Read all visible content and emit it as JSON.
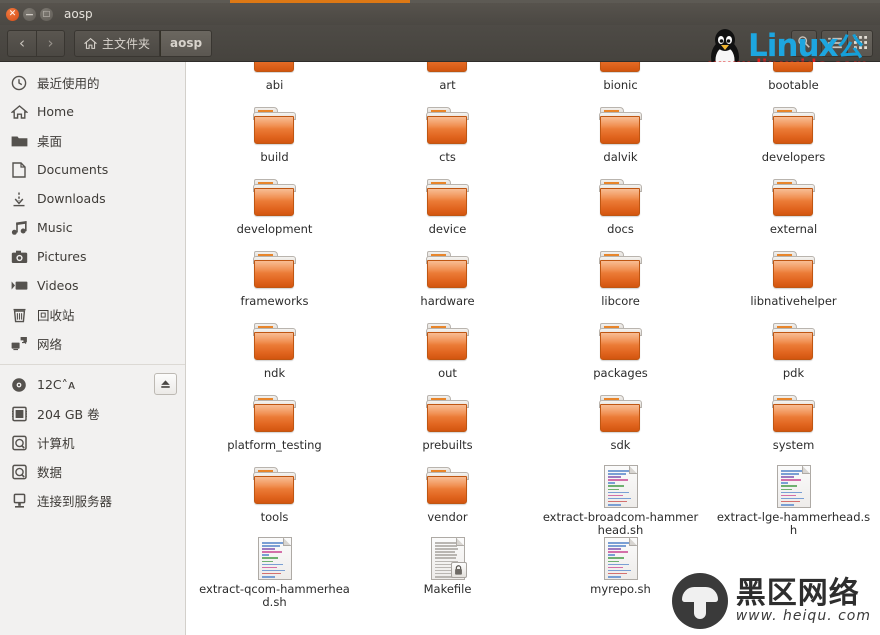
{
  "window": {
    "title": "aosp",
    "controls": [
      {
        "name": "close",
        "glyph": "✕"
      },
      {
        "name": "minimize",
        "glyph": "−"
      },
      {
        "name": "maximize",
        "glyph": "□"
      }
    ]
  },
  "toolbar": {
    "back_label": "‹",
    "forward_label": "›",
    "breadcrumbs": [
      {
        "label": "主文件夹",
        "icon": "home-icon",
        "current": false
      },
      {
        "label": "aosp",
        "icon": "",
        "current": true
      }
    ],
    "search_icon": "search-icon",
    "list_view_icon": "list-view-icon",
    "grid_view_icon": "grid-view-icon"
  },
  "sidebar": {
    "groups": [
      {
        "items": [
          {
            "label": "最近使用的",
            "icon": "clock-icon"
          },
          {
            "label": "Home",
            "icon": "home-icon"
          },
          {
            "label": "桌面",
            "icon": "folder-icon"
          },
          {
            "label": "Documents",
            "icon": "document-icon"
          },
          {
            "label": "Downloads",
            "icon": "download-icon"
          },
          {
            "label": "Music",
            "icon": "music-icon"
          },
          {
            "label": "Pictures",
            "icon": "camera-icon"
          },
          {
            "label": "Videos",
            "icon": "video-icon"
          },
          {
            "label": "回收站",
            "icon": "trash-icon"
          },
          {
            "label": "网络",
            "icon": "network-icon"
          }
        ]
      },
      {
        "items": [
          {
            "label": "12C˄ᴀ",
            "icon": "disc-icon",
            "eject": true
          },
          {
            "label": "204 GB 卷",
            "icon": "drive-icon"
          },
          {
            "label": "计算机",
            "icon": "harddisk-icon"
          },
          {
            "label": "数据",
            "icon": "harddisk-icon"
          },
          {
            "label": "连接到服务器",
            "icon": "server-icon"
          }
        ]
      }
    ]
  },
  "files": [
    {
      "name": "abi",
      "type": "folder",
      "clipped": true
    },
    {
      "name": "art",
      "type": "folder",
      "clipped": true
    },
    {
      "name": "bionic",
      "type": "folder",
      "clipped": true
    },
    {
      "name": "bootable",
      "type": "folder",
      "clipped": true
    },
    {
      "name": "build",
      "type": "folder"
    },
    {
      "name": "cts",
      "type": "folder"
    },
    {
      "name": "dalvik",
      "type": "folder"
    },
    {
      "name": "developers",
      "type": "folder"
    },
    {
      "name": "development",
      "type": "folder"
    },
    {
      "name": "device",
      "type": "folder"
    },
    {
      "name": "docs",
      "type": "folder"
    },
    {
      "name": "external",
      "type": "folder"
    },
    {
      "name": "frameworks",
      "type": "folder"
    },
    {
      "name": "hardware",
      "type": "folder"
    },
    {
      "name": "libcore",
      "type": "folder"
    },
    {
      "name": "libnativehelper",
      "type": "folder"
    },
    {
      "name": "ndk",
      "type": "folder"
    },
    {
      "name": "out",
      "type": "folder"
    },
    {
      "name": "packages",
      "type": "folder"
    },
    {
      "name": "pdk",
      "type": "folder"
    },
    {
      "name": "platform_testing",
      "type": "folder"
    },
    {
      "name": "prebuilts",
      "type": "folder"
    },
    {
      "name": "sdk",
      "type": "folder"
    },
    {
      "name": "system",
      "type": "folder"
    },
    {
      "name": "tools",
      "type": "folder"
    },
    {
      "name": "vendor",
      "type": "folder"
    },
    {
      "name": "extract-broadcom-hammerhead.sh",
      "type": "script"
    },
    {
      "name": "extract-lge-hammerhead.sh",
      "type": "script"
    },
    {
      "name": "extract-qcom-hammerhead.sh",
      "type": "script"
    },
    {
      "name": "Makefile",
      "type": "text",
      "locked": true
    },
    {
      "name": "myrepo.sh",
      "type": "script"
    }
  ],
  "watermarks": {
    "linux": {
      "brand": "Linux",
      "cn": "公社",
      "url": "www.linuxidc.com"
    },
    "heiqu": {
      "cn": "黑区网络",
      "url": "www. heiqu. com"
    }
  },
  "colors": {
    "titlebar": "#4b4843",
    "folder_orange": "#e1651f",
    "sidebar_bg": "#f2f1f0",
    "linux_blue": "#1da6e0",
    "url_red": "#e01f1f"
  }
}
